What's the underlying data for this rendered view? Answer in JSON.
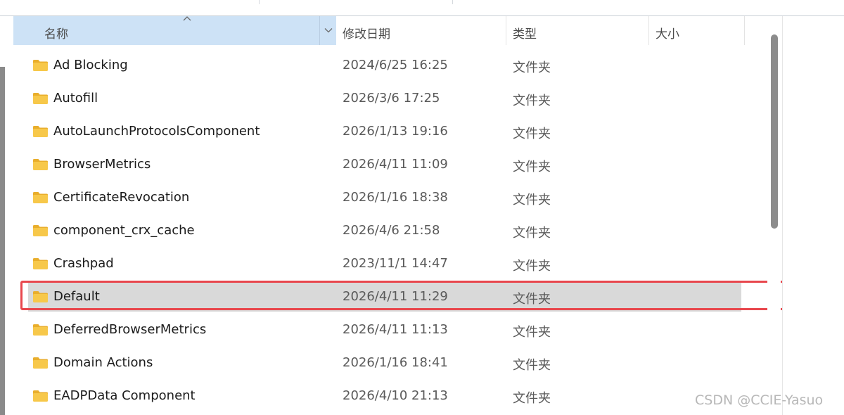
{
  "columns": {
    "name": "名称",
    "date": "修改日期",
    "type": "类型",
    "size": "大小"
  },
  "rows": [
    {
      "name": "Ad Blocking",
      "date": "2024/6/25 16:25",
      "type": "文件夹"
    },
    {
      "name": "Autofill",
      "date": "2026/3/6 17:25",
      "type": "文件夹"
    },
    {
      "name": "AutoLaunchProtocolsComponent",
      "date": "2026/1/13 19:16",
      "type": "文件夹"
    },
    {
      "name": "BrowserMetrics",
      "date": "2026/4/11 11:09",
      "type": "文件夹"
    },
    {
      "name": "CertificateRevocation",
      "date": "2026/1/16 18:38",
      "type": "文件夹"
    },
    {
      "name": "component_crx_cache",
      "date": "2026/4/6 21:58",
      "type": "文件夹"
    },
    {
      "name": "Crashpad",
      "date": "2023/11/1 14:47",
      "type": "文件夹"
    },
    {
      "name": "Default",
      "date": "2026/4/11 11:29",
      "type": "文件夹",
      "selected": true
    },
    {
      "name": "DeferredBrowserMetrics",
      "date": "2026/4/11 11:13",
      "type": "文件夹"
    },
    {
      "name": "Domain Actions",
      "date": "2026/1/16 18:41",
      "type": "文件夹"
    },
    {
      "name": "EADPData Component",
      "date": "2026/4/10 21:13",
      "type": "文件夹"
    }
  ],
  "watermark": "CSDN @CCIE-Yasuo",
  "colors": {
    "header_active": "#cde2f6",
    "selected_row": "#d9d9d9",
    "highlight_box": "#e8474d",
    "folder_body": "#f7c84a",
    "folder_tab": "#e9ae2c"
  },
  "icons": {
    "sort": "chevron-up-icon",
    "dropdown": "chevron-down-icon",
    "folder": "folder-icon"
  }
}
